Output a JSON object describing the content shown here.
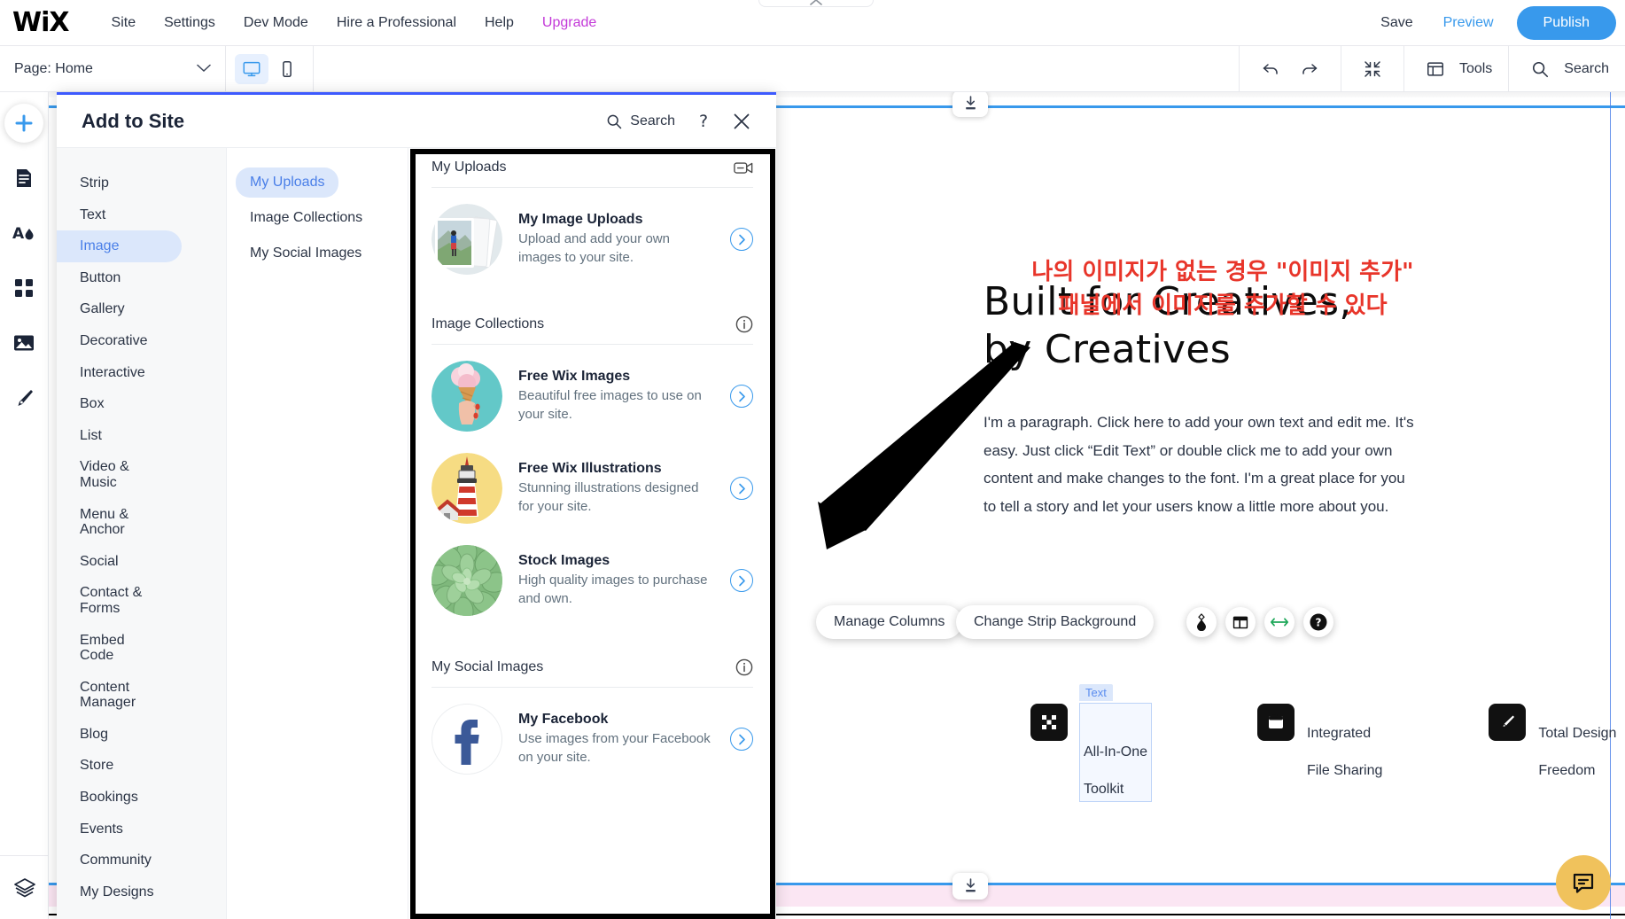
{
  "topbar": {
    "logo": "WiX",
    "menu": [
      {
        "label": "Site"
      },
      {
        "label": "Settings"
      },
      {
        "label": "Dev Mode"
      },
      {
        "label": "Hire a Professional"
      },
      {
        "label": "Help"
      },
      {
        "label": "Upgrade"
      }
    ],
    "save": "Save",
    "preview": "Preview",
    "publish": "Publish",
    "accent": "#3899ec",
    "upgrade_color": "#c339d8"
  },
  "subbar": {
    "page_label": "Page: Home",
    "desktop_icon": "desktop-icon",
    "mobile_icon": "mobile-icon",
    "undo_icon": "undo-icon",
    "redo_icon": "redo-icon",
    "zoomout_icon": "zoom-out-icon",
    "tools_label": "Tools",
    "search_label": "Search"
  },
  "left_rail": {
    "add_icon": "plus-icon",
    "items": [
      {
        "icon": "pages-icon"
      },
      {
        "icon": "theme-icon"
      },
      {
        "icon": "apps-icon"
      },
      {
        "icon": "media-icon"
      },
      {
        "icon": "pen-icon"
      }
    ],
    "bottom_icon": "layers-icon"
  },
  "add_panel": {
    "title": "Add to Site",
    "search_label": "Search",
    "help_icon": "question-mark-icon",
    "close_icon": "close-icon",
    "categories": [
      {
        "label": "Strip",
        "active": false
      },
      {
        "label": "Text",
        "active": false
      },
      {
        "label": "Image",
        "active": true
      },
      {
        "label": "Button",
        "active": false
      },
      {
        "label": "Gallery",
        "active": false
      },
      {
        "label": "Decorative",
        "active": false
      },
      {
        "label": "Interactive",
        "active": false
      },
      {
        "label": "Box",
        "active": false
      },
      {
        "label": "List",
        "active": false
      },
      {
        "label": "Video & Music",
        "active": false
      },
      {
        "label": "Menu & Anchor",
        "active": false
      },
      {
        "label": "Social",
        "active": false
      },
      {
        "label": "Contact & Forms",
        "active": false
      },
      {
        "label": "Embed Code",
        "active": false
      },
      {
        "label": "Content Manager",
        "active": false
      },
      {
        "label": "Blog",
        "active": false
      },
      {
        "label": "Store",
        "active": false
      },
      {
        "label": "Bookings",
        "active": false
      },
      {
        "label": "Events",
        "active": false
      },
      {
        "label": "Community",
        "active": false
      },
      {
        "label": "My Designs",
        "active": false
      }
    ],
    "subcategories": [
      {
        "label": "My Uploads",
        "active": true
      },
      {
        "label": "Image Collections",
        "active": false
      },
      {
        "label": "My Social Images",
        "active": false
      }
    ],
    "sections": [
      {
        "title": "My Uploads",
        "icon": "upload-media-icon",
        "cards": [
          {
            "title": "My Image Uploads",
            "desc": "Upload and add your own images to your site.",
            "thumb": "photo-stack-hiker",
            "chevron": "chevron-right-icon"
          }
        ]
      },
      {
        "title": "Image Collections",
        "icon": "info-icon",
        "cards": [
          {
            "title": "Free Wix Images",
            "desc": "Beautiful free images to use on your site.",
            "thumb": "ice-cream-cone",
            "chevron": "chevron-right-icon"
          },
          {
            "title": "Free Wix Illustrations",
            "desc": "Stunning illustrations designed for your site.",
            "thumb": "lighthouse",
            "chevron": "chevron-right-icon"
          },
          {
            "title": "Stock Images",
            "desc": "High quality images to purchase and own.",
            "thumb": "succulent",
            "chevron": "chevron-right-icon"
          }
        ]
      },
      {
        "title": "My Social Images",
        "icon": "info-icon",
        "cards": [
          {
            "title": "My Facebook",
            "desc": "Use images from your Facebook on your site.",
            "thumb": "facebook-logo",
            "chevron": "chevron-right-icon"
          }
        ]
      }
    ]
  },
  "canvas": {
    "annotation": "나의 이미지가 없는 경우 \"이미지 추가\"\n패널에서 이미지를 추가할 수 있다",
    "annotation_color": "#e8352a",
    "heading_line1": "Built for Creatives,",
    "heading_line2": "by Creatives",
    "paragraph": "I'm a paragraph. Click here to add your own text and edit me. It's easy. Just click “Edit Text” or double click me to add your own content and make changes to the font. I'm a great place for you to tell a story and let your users know a little more about you.",
    "pills": [
      {
        "label": "Manage Columns"
      },
      {
        "label": "Change Strip Background"
      }
    ],
    "round_buttons": [
      {
        "icon": "drop-icon"
      },
      {
        "icon": "layout-icon"
      },
      {
        "icon": "stretch-icon"
      },
      {
        "icon": "help-circle-icon"
      }
    ],
    "features": [
      {
        "icon": "grid-squares-icon",
        "line1": "All-In-One",
        "line2": "Toolkit",
        "selected": true,
        "tag": "Text"
      },
      {
        "icon": "window-icon",
        "line1": "Integrated",
        "line2": "File Sharing",
        "selected": false,
        "tag": ""
      },
      {
        "icon": "brush-icon",
        "line1": "Total Design",
        "line2": "Freedom",
        "selected": false,
        "tag": ""
      }
    ],
    "top_handle_icon": "add-section-icon",
    "bottom_handle_icon": "add-section-icon",
    "chat_icon": "chat-bubble-icon",
    "chat_color": "#f0c25c"
  }
}
